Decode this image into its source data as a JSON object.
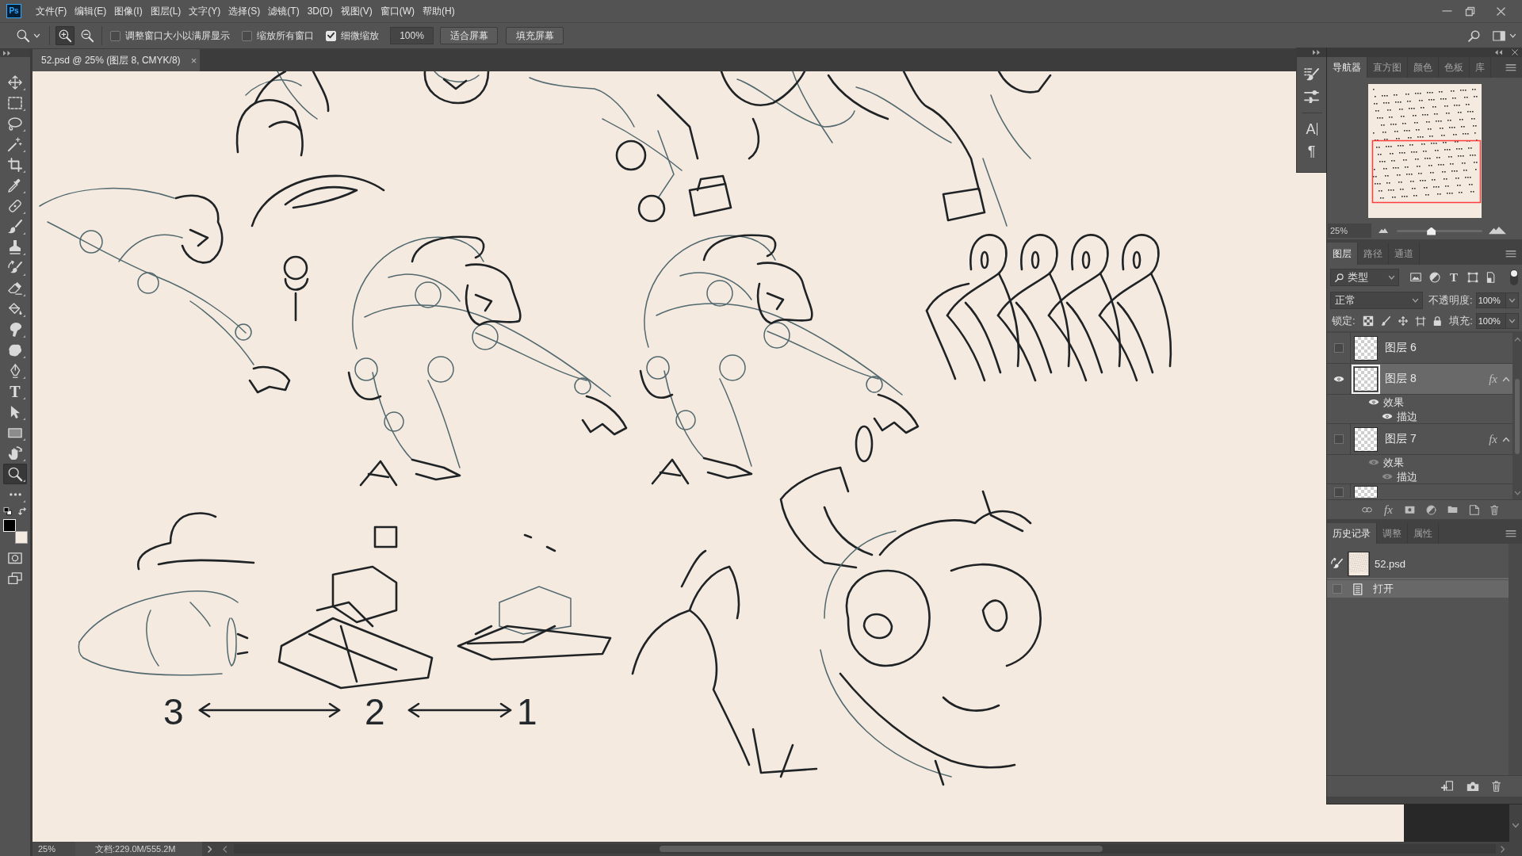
{
  "app_logo": "Ps",
  "menu_bar": {
    "items": [
      "文件(F)",
      "编辑(E)",
      "图像(I)",
      "图层(L)",
      "文字(Y)",
      "选择(S)",
      "滤镜(T)",
      "3D(D)",
      "视图(V)",
      "窗口(W)",
      "帮助(H)"
    ]
  },
  "options_bar": {
    "zoom_modes": [
      {
        "kind": "zoom-in",
        "selected": true
      },
      {
        "kind": "zoom-out",
        "selected": false
      }
    ],
    "checkboxes": [
      {
        "label": "调整窗口大小以满屏显示",
        "checked": false
      },
      {
        "label": "缩放所有窗口",
        "checked": false
      },
      {
        "label": "细微缩放",
        "checked": true
      }
    ],
    "zoom_value": "100%",
    "buttons": [
      "适合屏幕",
      "填充屏幕"
    ]
  },
  "toolbar": {
    "tools": [
      {
        "kind": "move",
        "selected": false
      },
      {
        "kind": "marquee",
        "selected": false
      },
      {
        "kind": "lasso",
        "selected": false
      },
      {
        "kind": "wand",
        "selected": false
      },
      {
        "kind": "crop",
        "selected": false
      },
      {
        "kind": "eyedropper",
        "selected": false
      },
      {
        "kind": "healing",
        "selected": false
      },
      {
        "kind": "brush",
        "selected": false
      },
      {
        "kind": "stamp",
        "selected": false
      },
      {
        "kind": "history-brush",
        "selected": false
      },
      {
        "kind": "eraser",
        "selected": false
      },
      {
        "kind": "bucket",
        "selected": false
      },
      {
        "kind": "smudge",
        "selected": false
      },
      {
        "kind": "sponge",
        "selected": false
      },
      {
        "kind": "pen",
        "selected": false
      },
      {
        "kind": "type",
        "glyph": "T",
        "selected": false
      },
      {
        "kind": "path-select",
        "selected": false
      },
      {
        "kind": "rectangle",
        "selected": false
      },
      {
        "kind": "rotate-view",
        "selected": false
      },
      {
        "kind": "zoom",
        "selected": true
      },
      {
        "kind": "more",
        "selected": false
      }
    ],
    "colors": [
      {
        "kind": "foreground",
        "color": "#000000"
      },
      {
        "kind": "background",
        "color": "#f5ebe0"
      }
    ]
  },
  "document_tab": {
    "title": "52.psd @ 25% (图层 8, CMYK/8)",
    "close": "×"
  },
  "canvas": {
    "scale_labels": [
      "3",
      "2",
      "1"
    ]
  },
  "status_bar": {
    "zoom": "25%",
    "document_size": "文档:229.0M/555.2M"
  },
  "panel_strip": {
    "items": [
      {
        "kind": "brushes"
      },
      {
        "kind": "brush-settings"
      },
      {
        "kind": "character",
        "glyph": "A"
      },
      {
        "kind": "paragraph",
        "glyph": "¶"
      }
    ]
  },
  "navigator_panel": {
    "tabs": [
      {
        "label": "导航器",
        "selected": true
      },
      {
        "label": "直方图",
        "selected": false
      },
      {
        "label": "颜色",
        "selected": false
      },
      {
        "label": "色板",
        "selected": false
      },
      {
        "label": "库",
        "selected": false
      }
    ],
    "zoom": "25%",
    "zoom_slider": {
      "level": 0.4
    }
  },
  "layers_panel": {
    "tabs": [
      {
        "label": "图层",
        "selected": true
      },
      {
        "label": "路径",
        "selected": false
      },
      {
        "label": "通道",
        "selected": false
      }
    ],
    "filter": {
      "value": "类型",
      "enabled": true
    },
    "filter_icons": [
      {
        "kind": "image"
      },
      {
        "kind": "adjustment"
      },
      {
        "kind": "type",
        "glyph": "T"
      },
      {
        "kind": "shape"
      },
      {
        "kind": "smart-object"
      }
    ],
    "blend_mode": "正常",
    "opacity_label": "不透明度:",
    "opacity": "100%",
    "lock_label": "锁定:",
    "fill_label": "填充:",
    "fill": "100%",
    "layers": [
      {
        "name": "图层 6",
        "visible": false,
        "selected": false
      },
      {
        "name": "图层 8",
        "visible": true,
        "selected": true,
        "fx": "fx",
        "expanded": true,
        "effects": [
          {
            "name": "效果",
            "visible": true,
            "children": [
              {
                "name": "描边",
                "visible": true
              }
            ]
          }
        ]
      },
      {
        "name": "图层 7",
        "visible": false,
        "selected": false,
        "fx": "fx",
        "expanded": true,
        "effects": [
          {
            "name": "效果",
            "visible": true,
            "children": [
              {
                "name": "描边",
                "visible": true
              }
            ]
          }
        ]
      },
      {
        "visible": false,
        "selected": false
      }
    ],
    "footer_icons": [
      {
        "kind": "link"
      },
      {
        "kind": "fx",
        "glyph": "fx"
      },
      {
        "kind": "mask"
      },
      {
        "kind": "adjustment"
      },
      {
        "kind": "group"
      },
      {
        "kind": "new"
      },
      {
        "kind": "delete"
      }
    ]
  },
  "history_panel": {
    "tabs": [
      {
        "label": "历史记录",
        "selected": true
      },
      {
        "label": "调整",
        "selected": false
      },
      {
        "label": "属性",
        "selected": false
      }
    ],
    "snapshot": {
      "name": "52.psd",
      "source": true
    },
    "states": [
      {
        "name": "打开",
        "selected": true,
        "source": false
      }
    ]
  }
}
